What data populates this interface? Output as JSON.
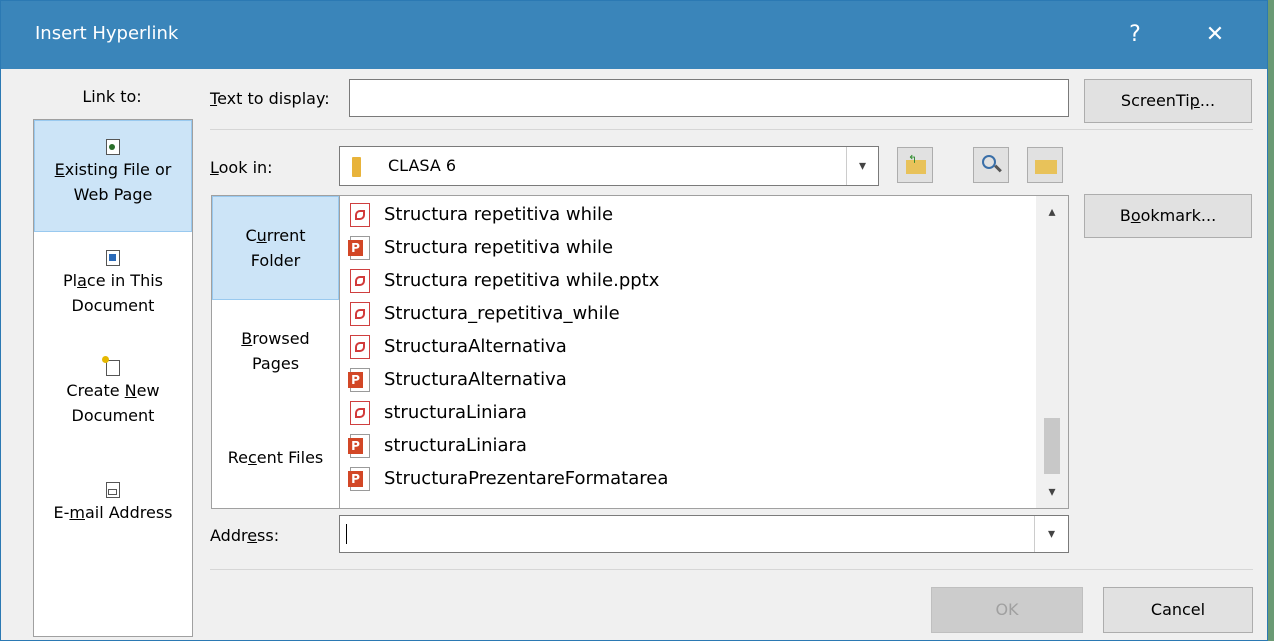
{
  "window": {
    "title": "Insert Hyperlink",
    "help_glyph": "?",
    "close_glyph": "✕"
  },
  "link_to": {
    "label": "Link to:",
    "items": [
      {
        "line1": "Existing File or",
        "line2": "Web Page",
        "selected": true,
        "icon": "existing-file-icon"
      },
      {
        "line1": "Place in This",
        "line2": "Document",
        "selected": false,
        "icon": "place-in-document-icon"
      },
      {
        "line1": "Create New",
        "line2": "Document",
        "selected": false,
        "icon": "new-document-icon"
      },
      {
        "line1": "E-mail Address",
        "line2": "",
        "selected": false,
        "icon": "email-icon"
      }
    ]
  },
  "text_to_display": {
    "label": "Text to display:",
    "value": ""
  },
  "screentip_button": "ScreenTip...",
  "look_in": {
    "label": "Look in:",
    "value": "CLASA 6",
    "icon": "folder-icon"
  },
  "toolbar_icons": [
    "up-folder-icon",
    "browse-web-icon",
    "browse-file-icon"
  ],
  "sources": [
    {
      "line1": "Current",
      "line2": "Folder",
      "selected": true
    },
    {
      "line1": "Browsed",
      "line2": "Pages",
      "selected": false
    },
    {
      "line1": "Recent Files",
      "line2": "",
      "selected": false
    }
  ],
  "files": [
    {
      "name": "Structura repetitiva while",
      "type": "pdf"
    },
    {
      "name": "Structura repetitiva while",
      "type": "ppt"
    },
    {
      "name": "Structura repetitiva while.pptx",
      "type": "pdf"
    },
    {
      "name": "Structura_repetitiva_while",
      "type": "pdf"
    },
    {
      "name": "StructuraAlternativa",
      "type": "pdf"
    },
    {
      "name": "StructuraAlternativa",
      "type": "ppt"
    },
    {
      "name": "structuraLiniara",
      "type": "pdf"
    },
    {
      "name": "structuraLiniara",
      "type": "ppt"
    },
    {
      "name": "StructuraPrezentareFormatarea",
      "type": "ppt"
    }
  ],
  "bookmark_button": "Bookmark...",
  "address": {
    "label": "Address:",
    "value": ""
  },
  "ok_button": "OK",
  "cancel_button": "Cancel",
  "colors": {
    "titlebar": "#3a85ba",
    "selected": "#cce4f7",
    "dialog_bg": "#f0f0f0"
  }
}
